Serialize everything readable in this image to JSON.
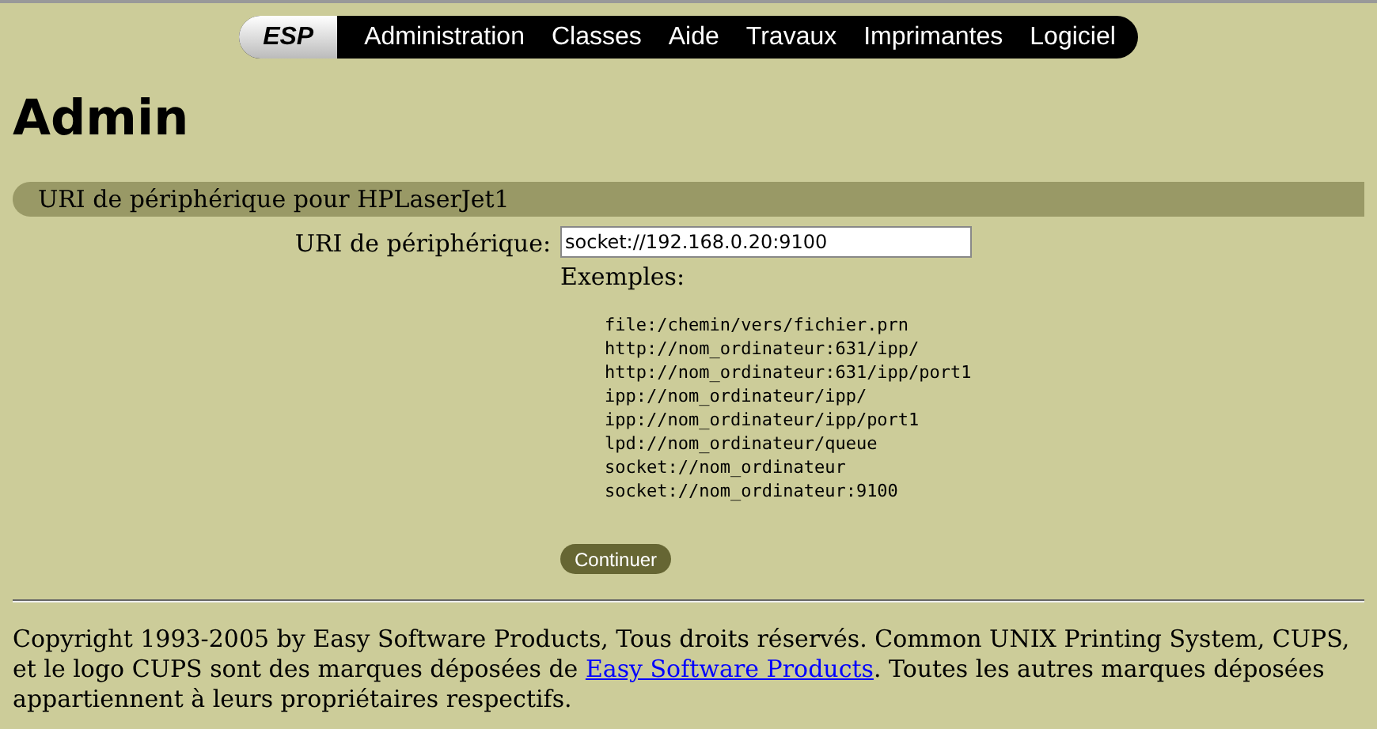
{
  "nav": {
    "logo": "ESP",
    "items": [
      "Administration",
      "Classes",
      "Aide",
      "Travaux",
      "Imprimantes",
      "Logiciel"
    ]
  },
  "heading": "Admin",
  "section": {
    "title": "URI de périphérique pour HPLaserJet1"
  },
  "form": {
    "label": "URI de périphérique:",
    "value": "socket://192.168.0.20:9100",
    "examples_label": "Exemples:",
    "examples": [
      "file:/chemin/vers/fichier.prn",
      "http://nom_ordinateur:631/ipp/",
      "http://nom_ordinateur:631/ipp/port1",
      "ipp://nom_ordinateur/ipp/",
      "ipp://nom_ordinateur/ipp/port1",
      "lpd://nom_ordinateur/queue",
      "socket://nom_ordinateur",
      "socket://nom_ordinateur:9100"
    ],
    "button": "Continuer"
  },
  "footer": {
    "text_before": "Copyright 1993-2005 by Easy Software Products, Tous droits réservés. Common UNIX Printing System, CUPS, et le logo CUPS sont des marques déposées de ",
    "link": "Easy Software Products",
    "text_after": ". Toutes les autres marques déposées appartiennent à leurs propriétaires respectifs."
  }
}
